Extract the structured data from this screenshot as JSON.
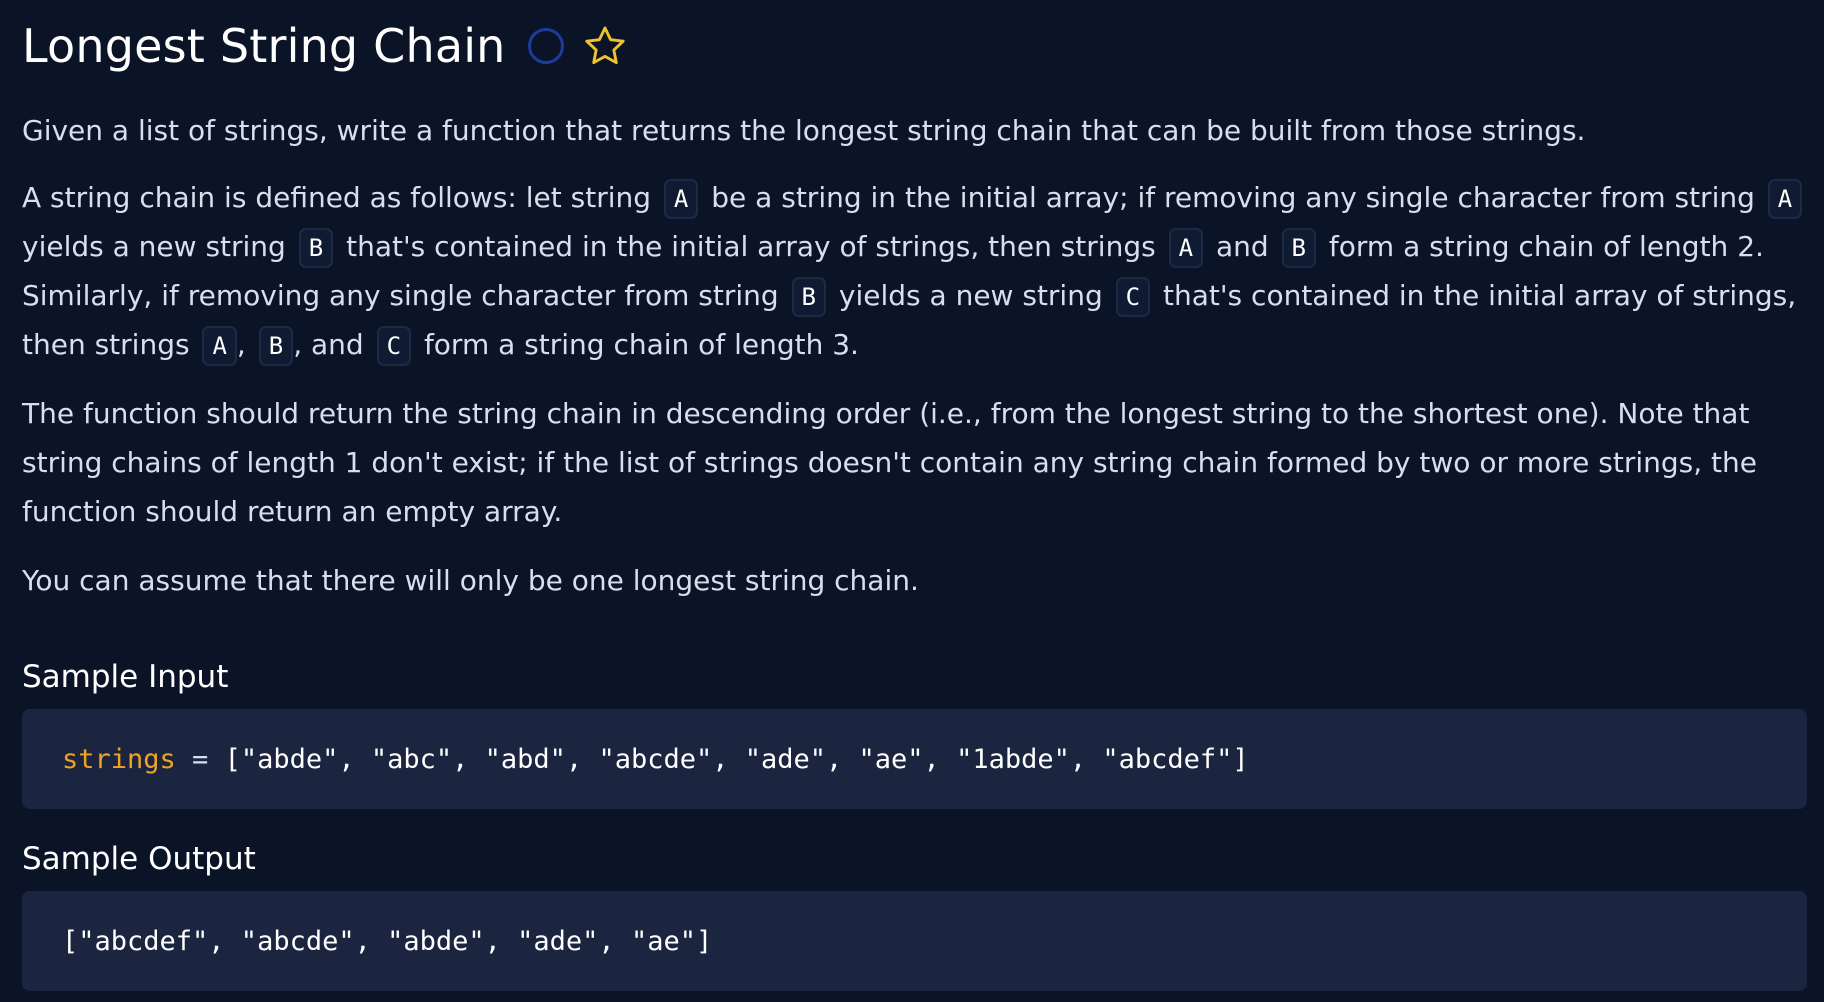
{
  "problem": {
    "title": "Longest String Chain",
    "status_icon": "circle-icon",
    "favorite_icon": "star-icon",
    "accent_colors": {
      "circle": "#1f3a9e",
      "star": "#f2c12e",
      "variable": "#f0a322"
    }
  },
  "description": {
    "p1": "Given a list of strings, write a function that returns the longest string chain that can be built from those strings.",
    "p2": {
      "t1": "A string chain is defined as follows: let string",
      "c1": "A",
      "t2": "be a string in the initial array; if removing any single character from string",
      "c2": "A",
      "t3": "yields a new string",
      "c3": "B",
      "t4": "that's contained in the initial array of strings, then strings",
      "c4": "A",
      "t5": "and",
      "c5": "B",
      "t6": "form a string chain of length 2. Similarly, if removing any single character from string",
      "c6": "B",
      "t7": "yields a new string",
      "c7": "C",
      "t8": "that's contained in the initial array of strings, then strings",
      "c8": "A",
      "t9": ",",
      "c9": "B",
      "t10": ", and",
      "c10": "C",
      "t11": "form a string chain of length 3."
    },
    "p3": "The function should return the string chain in descending order (i.e., from the longest string to the shortest one). Note that string chains of length 1 don't exist; if the list of strings doesn't contain any string chain formed by two or more strings, the function should return an empty array.",
    "p4": "You can assume that there will only be one longest string chain."
  },
  "sample_input": {
    "heading": "Sample Input",
    "variable": "strings",
    "operator": " = ",
    "value": "[\"abde\", \"abc\", \"abd\", \"abcde\", \"ade\", \"ae\", \"1abde\", \"abcdef\"]"
  },
  "sample_output": {
    "heading": "Sample Output",
    "value": "[\"abcdef\", \"abcde\", \"abde\", \"ade\", \"ae\"]"
  }
}
